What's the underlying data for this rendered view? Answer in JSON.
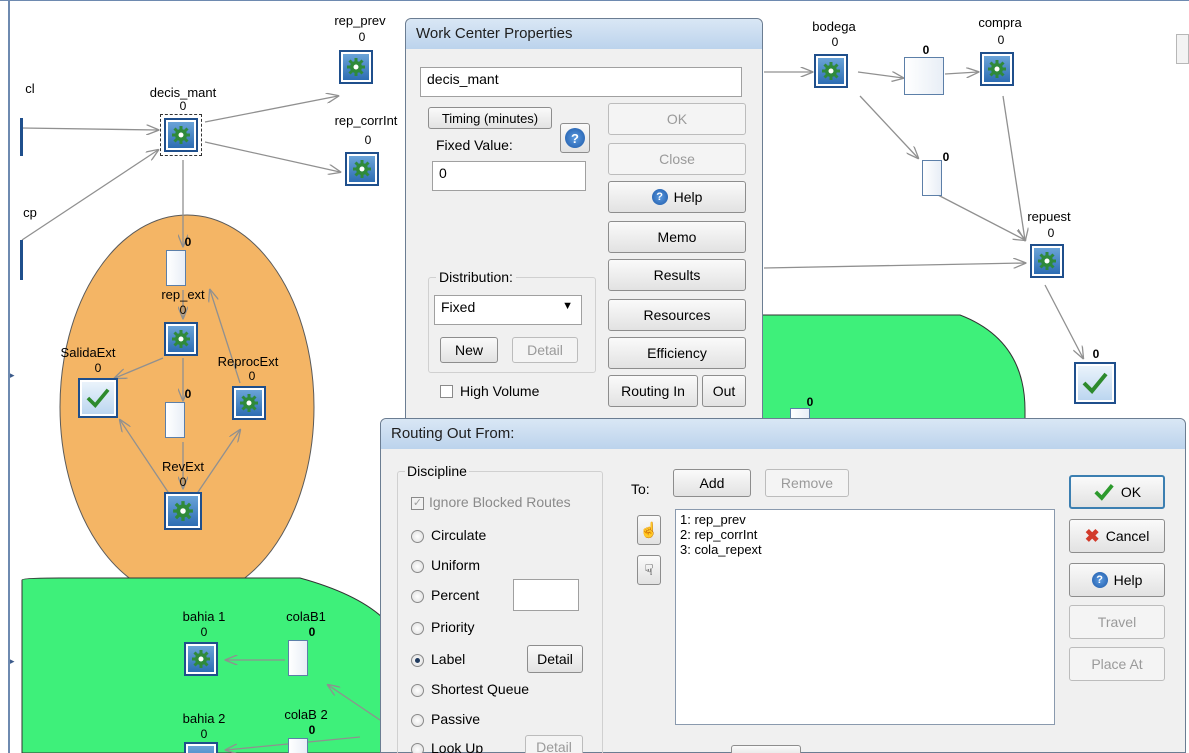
{
  "model": {
    "nodes": {
      "cl": "cl",
      "cp": "cp",
      "decis_mant": "decis_mant",
      "rep_prev": "rep_prev",
      "rep_corrInt": "rep_corrInt",
      "bodega": "bodega",
      "compra": "compra",
      "repuest": "repuest",
      "rep_ext": "rep_ext",
      "SalidaExt": "SalidaExt",
      "ReprocExt": "ReprocExt",
      "RevExt": "RevExt",
      "bahia1": "bahia 1",
      "colaB1": "colaB1",
      "bahia2": "bahia 2",
      "colaB2": "colaB 2"
    },
    "zero": "0"
  },
  "work_center_dialog": {
    "title": "Work Center Properties",
    "name_value": "decis_mant",
    "timing_tab": "Timing (minutes)",
    "fixed_value_label": "Fixed Value:",
    "fixed_value": "0",
    "distribution_label": "Distribution:",
    "distribution_value": "Fixed",
    "new_button": "New",
    "detail_button": "Detail",
    "high_volume_label": "High Volume",
    "buttons": {
      "ok": "OK",
      "close": "Close",
      "help": "Help",
      "memo": "Memo",
      "results": "Results",
      "resources": "Resources",
      "efficiency": "Efficiency",
      "routing_in": "Routing In",
      "out": "Out"
    }
  },
  "routing_dialog": {
    "title": "Routing Out From:",
    "discipline_label": "Discipline",
    "ignore_blocked": "Ignore Blocked Routes",
    "options": [
      "Circulate",
      "Uniform",
      "Percent",
      "Priority",
      "Label",
      "Shortest Queue",
      "Passive",
      "Look Up"
    ],
    "selected": "Label",
    "detail_button": "Detail",
    "to_label": "To:",
    "add_button": "Add",
    "remove_button": "Remove",
    "routes": [
      "1: rep_prev",
      "2: rep_corrInt",
      "3: cola_repext"
    ],
    "ok_button": "OK",
    "cancel_button": "Cancel",
    "help_button": "Help",
    "travel_button": "Travel",
    "place_at_button": "Place At"
  },
  "colors": {
    "orange_region": "#f4b565",
    "green_region": "#3ef07a",
    "node_border": "#1f4f8c",
    "dialog_bg": "#f0f0f0"
  },
  "icons": {
    "work_center": "gear-icon",
    "exit": "checkmark-icon",
    "help": "help-icon",
    "cancel": "x-icon"
  }
}
